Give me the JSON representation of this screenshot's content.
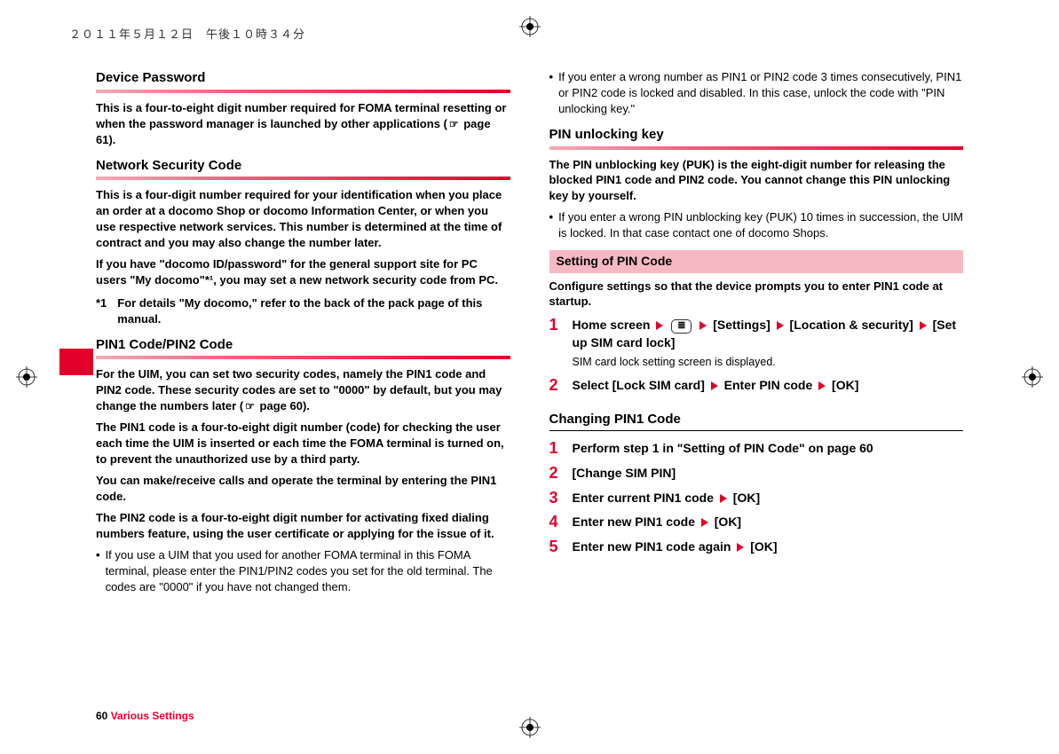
{
  "timestamp": "２０１１年５月１２日　午後１０時３４分",
  "left": {
    "h1": "Device Password",
    "p1": "This is a four-to-eight digit number required for FOMA terminal resetting or when the password manager is launched by other applications (",
    "p1_ref": " page 61).",
    "h2": "Network Security Code",
    "p2": "This is a four-digit number required for your identification when you place an order at a docomo Shop or docomo Information Center, or when you use respective network services. This number is determined at the time of contract and you may also change the number later.",
    "p3": "If you have \"docomo ID/password\" for the general support site for PC users \"My docomo\"*¹, you may set a new network security code from PC.",
    "fn_num": "*1",
    "fn_txt": "For details \"My docomo,\" refer to the back of the pack page of this manual.",
    "h3": "PIN1 Code/PIN2 Code",
    "p4": "For the UIM, you can set two security codes, namely the PIN1 code and PIN2 code. These security codes are set to \"0000\" by default, but you may change the numbers later (",
    "p4_ref": " page 60).",
    "p5": "The PIN1 code is a four-to-eight digit number (code) for checking the user each time the UIM is inserted or each time the FOMA terminal is turned on, to prevent the unauthorized use by a third party.",
    "p6": "You can make/receive calls and operate the terminal by entering the PIN1 code.",
    "p7": "The PIN2 code is a four-to-eight digit number for activating fixed dialing numbers feature, using the user certificate or applying for the issue of it.",
    "b1": "If you use a UIM that you used for another FOMA terminal in this FOMA terminal, please enter the PIN1/PIN2 codes you set for the old terminal. The codes are \"0000\" if you have not changed them."
  },
  "right": {
    "b1": "If you enter a wrong number as PIN1 or PIN2 code 3 times consecutively, PIN1 or PIN2 code is locked and disabled. In this case, unlock the code with \"PIN unlocking key.\"",
    "h1": "PIN unlocking key",
    "p1": "The PIN unblocking key (PUK) is the eight-digit number for releasing the blocked PIN1 code and PIN2 code. You cannot change this PIN unlocking key by yourself.",
    "b2": "If you enter a wrong PIN unblocking key (PUK) 10 times in succession, the UIM is locked. In that case contact one of docomo Shops.",
    "box1": "Setting of PIN Code",
    "p2": "Configure settings so that the device prompts you to enter PIN1 code at startup.",
    "s1_a": "Home screen ",
    "s1_b": " [Settings] ",
    "s1_c": " [Location & security] ",
    "s1_d": " [Set up SIM card lock]",
    "s1_sub": "SIM card lock setting screen is displayed.",
    "s2_a": "Select [Lock SIM card] ",
    "s2_b": " Enter PIN code ",
    "s2_c": " [OK]",
    "h2": "Changing PIN1 Code",
    "c1": "Perform step 1 in \"Setting of PIN Code\" on page 60",
    "c2": "[Change SIM PIN]",
    "c3_a": "Enter current PIN1 code ",
    "c3_b": " [OK]",
    "c4_a": "Enter new PIN1 code ",
    "c4_b": " [OK]",
    "c5_a": "Enter new PIN1 code again ",
    "c5_b": " [OK]"
  },
  "footer": {
    "page": "60",
    "section": "Various Settings"
  },
  "key_glyph": "≣"
}
